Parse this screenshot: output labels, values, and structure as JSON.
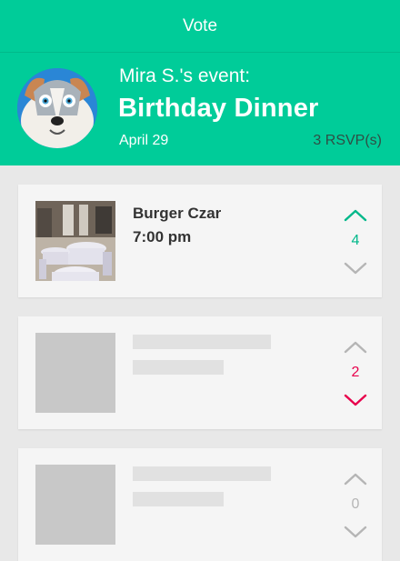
{
  "topbar": {
    "title": "Vote"
  },
  "event": {
    "host_line": "Mira S.'s event:",
    "title": "Birthday Dinner",
    "date": "April 29",
    "rsvp": "3 RSVP(s)"
  },
  "options": [
    {
      "name": "Burger Czar",
      "time": "7:00 pm",
      "votes": "4",
      "vote_state": "up"
    },
    {
      "name": "",
      "time": "",
      "votes": "2",
      "vote_state": "down"
    },
    {
      "name": "",
      "time": "",
      "votes": "0",
      "vote_state": "none"
    }
  ],
  "colors": {
    "brand": "#00cc99",
    "upvote": "#00b88a",
    "downvote": "#e8004c",
    "neutral": "#b5b5b5",
    "placeholder": "#c8c8c8"
  }
}
